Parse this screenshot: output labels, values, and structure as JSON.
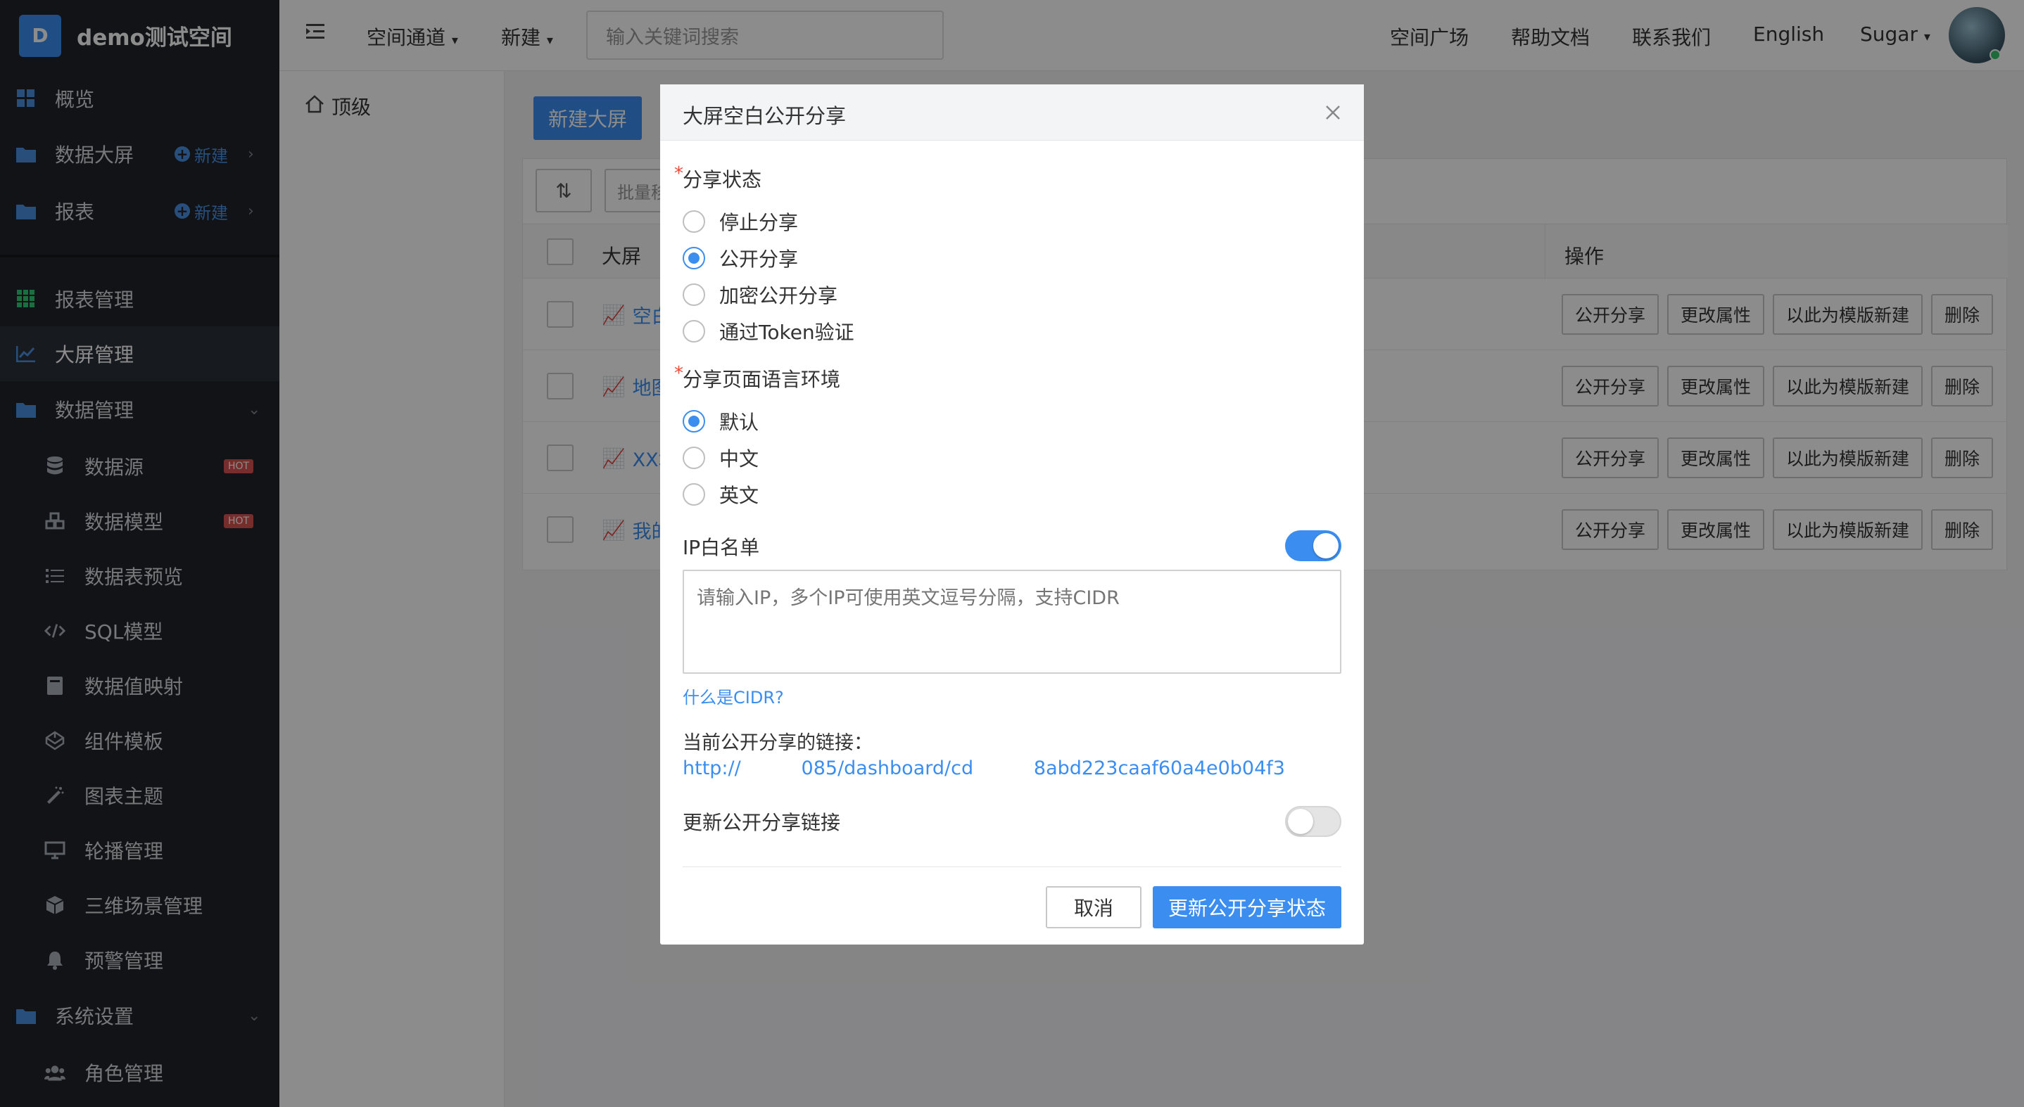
{
  "brand": {
    "logo_letter": "D",
    "name": "demo测试空间"
  },
  "sidebar": {
    "overview": "概览",
    "data_screen": "数据大屏",
    "report": "报表",
    "new_label": "新建",
    "report_mgmt": "报表管理",
    "screen_mgmt": "大屏管理",
    "data_mgmt": "数据管理",
    "data_source": "数据源",
    "data_model": "数据模型",
    "table_preview": "数据表预览",
    "sql_model": "SQL模型",
    "value_mapping": "数据值映射",
    "component_template": "组件模板",
    "chart_theme": "图表主题",
    "carousel_mgmt": "轮播管理",
    "scene_3d_mgmt": "三维场景管理",
    "alert_mgmt": "预警管理",
    "system_settings": "系统设置",
    "role_mgmt": "角色管理",
    "hot": "HOT"
  },
  "topbar": {
    "space_channel": "空间通道",
    "new": "新建",
    "search_placeholder": "输入关键词搜索",
    "space_square": "空间广场",
    "help_docs": "帮助文档",
    "contact_us": "联系我们",
    "language": "English",
    "user": "Sugar"
  },
  "content": {
    "breadcrumb": "顶级",
    "new_screen_btn": "新建大屏",
    "batch_placeholder": "批量移",
    "col_screen": "大屏",
    "col_ops": "操作",
    "rows": [
      {
        "name": "空白"
      },
      {
        "name": "地图"
      },
      {
        "name": "XX城"
      },
      {
        "name": "我的"
      }
    ],
    "ops": {
      "public_share": "公开分享",
      "change_props": "更改属性",
      "template_new": "以此为模版新建",
      "delete": "删除"
    }
  },
  "modal": {
    "title": "大屏空白公开分享",
    "share_status_label": "分享状态",
    "share_options": [
      "停止分享",
      "公开分享",
      "加密公开分享",
      "通过Token验证"
    ],
    "share_selected": 1,
    "lang_label": "分享页面语言环境",
    "lang_options": [
      "默认",
      "中文",
      "英文"
    ],
    "lang_selected": 0,
    "ip_whitelist_label": "IP白名单",
    "ip_whitelist_on": true,
    "ip_placeholder": "请输入IP，多个IP可使用英文逗号分隔，支持CIDR",
    "cidr_link": "什么是CIDR?",
    "current_link_label": "当前公开分享的链接：",
    "current_link": "http://          085/dashboard/cd          8abd223caaf60a4e0b04f3",
    "update_link_label": "更新公开分享链接",
    "update_link_on": false,
    "cancel": "取消",
    "confirm": "更新公开分享状态"
  }
}
